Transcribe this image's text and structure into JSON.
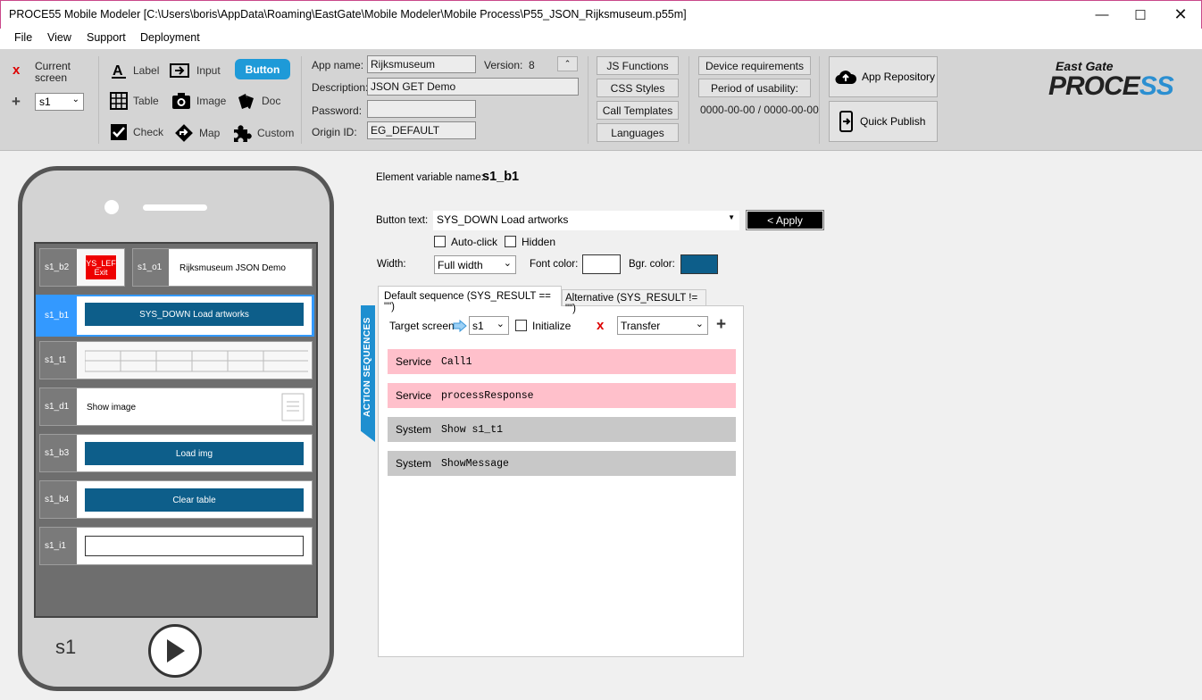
{
  "window": {
    "title": "PROCE55 Mobile Modeler [C:\\Users\\boris\\AppData\\Roaming\\EastGate\\Mobile Modeler\\Mobile Process\\P55_JSON_Rijksmuseum.p55m]"
  },
  "menu": [
    "File",
    "View",
    "Support",
    "Deployment"
  ],
  "toolbar": {
    "current_screen_label": "Current screen",
    "current_screen_value": "s1",
    "tools": {
      "label": "Label",
      "input": "Input",
      "button": "Button",
      "table": "Table",
      "image": "Image",
      "doc": "Doc",
      "check": "Check",
      "map": "Map",
      "custom": "Custom"
    },
    "app_name_label": "App name:",
    "app_name": "Rijksmuseum",
    "version_label": "Version:",
    "version": "8",
    "description_label": "Description:",
    "description": "JSON GET Demo",
    "password_label": "Password:",
    "password": "",
    "origin_label": "Origin ID:",
    "origin": "EG_DEFAULT",
    "js_functions": "JS Functions",
    "css_styles": "CSS Styles",
    "call_templates": "Call Templates",
    "languages": "Languages",
    "device_requirements": "Device requirements",
    "period": "Period of usability:",
    "period_value": "0000-00-00 / 0000-00-00",
    "app_repository": "App Repository",
    "quick_publish": "Quick Publish",
    "logo_top": "East Gate",
    "logo_main_a": "PROCE",
    "logo_main_b": "SS"
  },
  "phone": {
    "rows": [
      {
        "id": "s1_b2",
        "id2": "s1_o1",
        "btn": "YS_LEF Exit",
        "text": "Rijksmuseum JSON Demo"
      },
      {
        "id": "s1_b1",
        "btn": "SYS_DOWN Load artworks"
      },
      {
        "id": "s1_t1"
      },
      {
        "id": "s1_d1",
        "text": "Show image"
      },
      {
        "id": "s1_b3",
        "btn": "Load img"
      },
      {
        "id": "s1_b4",
        "btn": "Clear table"
      },
      {
        "id": "s1_i1"
      }
    ],
    "screen_name": "s1"
  },
  "editor": {
    "var_label": "Element variable name:",
    "var_name": "s1_b1",
    "button_text_label": "Button text:",
    "button_text": "SYS_DOWN Load artworks",
    "apply": "< Apply",
    "auto_click": "Auto-click",
    "hidden": "Hidden",
    "width_label": "Width:",
    "width_value": "Full width",
    "font_color_label": "Font color:",
    "bgr_color_label": "Bgr. color:",
    "font_color": "#ffffff",
    "bgr_color": "#0d5e8a",
    "tab_default": "Default sequence (SYS_RESULT == \"\")",
    "tab_alt": "Alternative (SYS_RESULT != \"\")",
    "side_tab": "ACTION SEQUENCES",
    "target_label": "Target screen",
    "target_value": "s1",
    "initialize": "Initialize",
    "transfer": "Transfer",
    "sequence": [
      {
        "kind": "Service",
        "value": "Call1",
        "color": "#ffc0cb"
      },
      {
        "kind": "Service",
        "value": "processResponse",
        "color": "#ffc0cb"
      },
      {
        "kind": "System",
        "value": "Show s1_t1",
        "color": "#c8c8c8"
      },
      {
        "kind": "System",
        "value": "ShowMessage",
        "color": "#c8c8c8"
      }
    ]
  }
}
